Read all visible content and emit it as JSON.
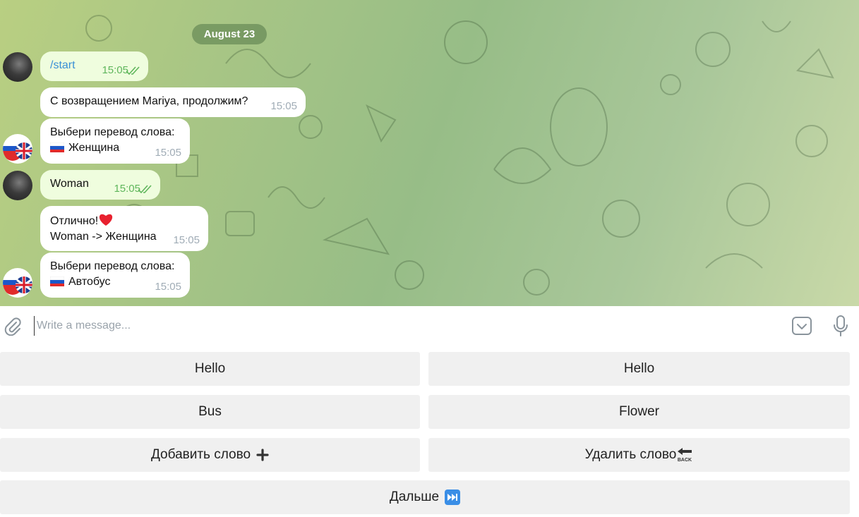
{
  "chat": {
    "date": "August 23",
    "messages": [
      {
        "text": "/start",
        "time": "15:05"
      },
      {
        "text": "С возвращением Mariya, продолжим?",
        "time": "15:05"
      },
      {
        "line1": "Выбери перевод слова:",
        "line2": "Женщина",
        "time": "15:05"
      },
      {
        "text": "Woman",
        "time": "15:05"
      },
      {
        "line1": "Отлично!",
        "line2": "Woman -> Женщина",
        "time": "15:05"
      },
      {
        "line1": "Выбери перевод слова:",
        "line2": "Автобус",
        "time": "15:05"
      }
    ]
  },
  "composer": {
    "placeholder": "Write a message..."
  },
  "keyboard": {
    "buttons": [
      {
        "label": "Hello"
      },
      {
        "label": "Hello"
      },
      {
        "label": "Bus"
      },
      {
        "label": "Flower"
      },
      {
        "label": "Добавить слово"
      },
      {
        "label": "Удалить слово"
      },
      {
        "label": "Дальше"
      }
    ]
  },
  "icons": {
    "attach": "paperclip-icon",
    "keyboard_toggle": "keyboard-toggle-icon",
    "mic": "microphone-icon",
    "read": "double-check-icon",
    "heart": "red-heart-emoji",
    "add": "plus-emoji",
    "back": "back-arrow-emoji",
    "next": "fast-forward-emoji"
  },
  "colors": {
    "outgoing_bubble": "#effdde",
    "incoming_bubble": "#ffffff",
    "link": "#3a8fd6",
    "read_ticks": "#5fb65c",
    "keyboard_button": "#f0f0f0"
  }
}
